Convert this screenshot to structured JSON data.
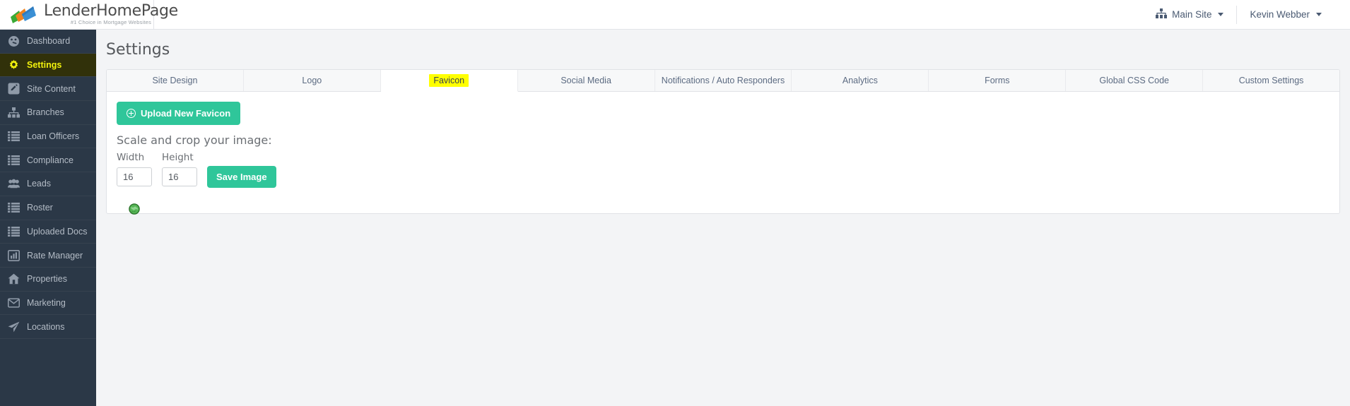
{
  "brand": {
    "name": "LenderHomePage",
    "tagline": "#1 Choice in Mortgage Websites",
    "logo_icon": "fanned-pages-logo-icon"
  },
  "topbar": {
    "site_selector": {
      "label": "Main Site",
      "icon": "sitemap-icon"
    },
    "user_menu": {
      "label": "Kevin Webber",
      "icon": "chevron-down-icon"
    }
  },
  "sidebar": {
    "items": [
      {
        "label": "Dashboard",
        "icon": "dashboard-gauge-icon",
        "active": false
      },
      {
        "label": "Settings",
        "icon": "gear-icon",
        "active": true
      },
      {
        "label": "Site Content",
        "icon": "pencil-square-icon",
        "active": false
      },
      {
        "label": "Branches",
        "icon": "sitemap-icon",
        "active": false
      },
      {
        "label": "Loan Officers",
        "icon": "list-icon",
        "active": false
      },
      {
        "label": "Compliance",
        "icon": "list-icon",
        "active": false
      },
      {
        "label": "Leads",
        "icon": "users-icon",
        "active": false
      },
      {
        "label": "Roster",
        "icon": "list-icon",
        "active": false
      },
      {
        "label": "Uploaded Docs",
        "icon": "list-icon",
        "active": false
      },
      {
        "label": "Rate Manager",
        "icon": "bar-chart-icon",
        "active": false
      },
      {
        "label": "Properties",
        "icon": "home-icon",
        "active": false
      },
      {
        "label": "Marketing",
        "icon": "envelope-icon",
        "active": false
      },
      {
        "label": "Locations",
        "icon": "paper-plane-icon",
        "active": false
      }
    ]
  },
  "page": {
    "title": "Settings"
  },
  "tabs": [
    {
      "label": "Site Design",
      "active": false
    },
    {
      "label": "Logo",
      "active": false
    },
    {
      "label": "Favicon",
      "active": true
    },
    {
      "label": "Social Media",
      "active": false
    },
    {
      "label": "Notifications / Auto Responders",
      "active": false
    },
    {
      "label": "Analytics",
      "active": false
    },
    {
      "label": "Forms",
      "active": false
    },
    {
      "label": "Global CSS Code",
      "active": false
    },
    {
      "label": "Custom Settings",
      "active": false
    }
  ],
  "favicon_panel": {
    "upload_button": "Upload New Favicon",
    "upload_icon": "plus-circle-icon",
    "scale_heading": "Scale and crop your image:",
    "width_label": "Width",
    "height_label": "Height",
    "width_value": "16",
    "height_value": "16",
    "save_button": "Save Image",
    "preview_icon": "globe-favicon-icon"
  },
  "colors": {
    "sidebar_bg": "#2b3847",
    "active_nav_bg": "#31310a",
    "active_nav_text": "#f2f20d",
    "accent_green": "#2fc69a",
    "active_tab_highlight": "#ffff00",
    "page_bg": "#f3f4f6"
  }
}
